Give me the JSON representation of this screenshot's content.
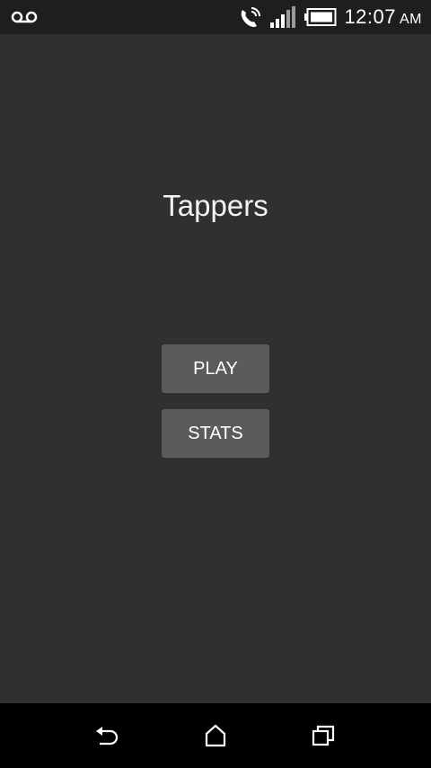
{
  "status_bar": {
    "time": "12:07",
    "ampm": "AM",
    "icons": {
      "left": "voicemail-icon",
      "right": [
        "wifi-calling-icon",
        "signal-icon",
        "battery-icon"
      ]
    }
  },
  "main": {
    "title": "Tappers",
    "play_label": "PLAY",
    "stats_label": "STATS"
  },
  "nav_bar": {
    "icons": [
      "back-icon",
      "home-icon",
      "recents-icon"
    ]
  },
  "colors": {
    "background": "#303030",
    "status_bar": "#1e1e1e",
    "button": "#5b5b5b",
    "nav_bar": "#000000",
    "text": "#ffffff"
  }
}
